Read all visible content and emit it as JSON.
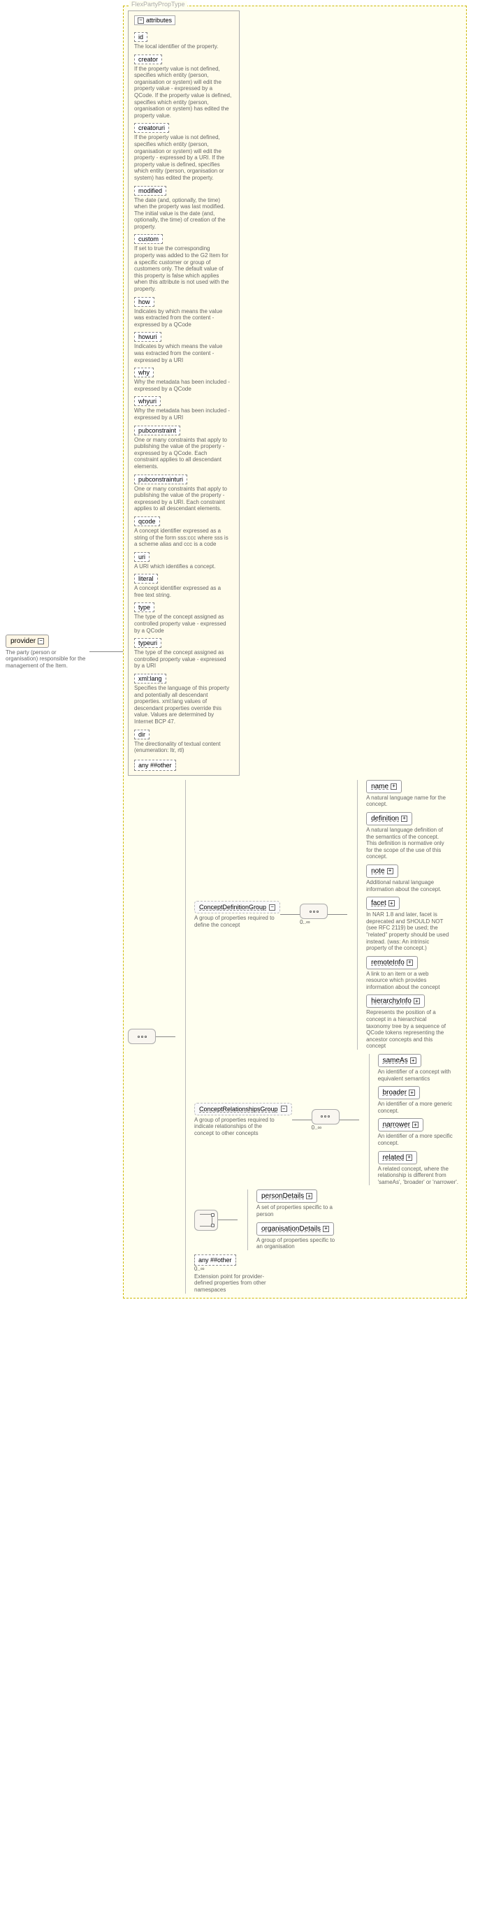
{
  "root": {
    "name": "provider",
    "annotation": "The party (person or organisation) responsible for the management of the Item."
  },
  "typeName": "FlexPartyPropType",
  "attributesHeader": "attributes",
  "otherAny": "any ##other",
  "attrs": [
    {
      "name": "id",
      "ann": "The local identifier of the property."
    },
    {
      "name": "creator",
      "ann": "If the property value is not defined, specifies which entity (person, organisation or system) will edit the property value - expressed by a QCode. If the property value is defined, specifies which entity (person, organisation or system) has edited the property value."
    },
    {
      "name": "creatoruri",
      "ann": "If the property value is not defined, specifies which entity (person, organisation or system) will edit the property - expressed by a URI. If the property value is defined, specifies which entity (person, organisation or system) has edited the property."
    },
    {
      "name": "modified",
      "ann": "The date (and, optionally, the time) when the property was last modified. The initial value is the date (and, optionally, the time) of creation of the property."
    },
    {
      "name": "custom",
      "ann": "If set to true the corresponding property was added to the G2 Item for a specific customer or group of customers only. The default value of this property is false which applies when this attribute is not used with the property."
    },
    {
      "name": "how",
      "ann": "Indicates by which means the value was extracted from the content - expressed by a QCode"
    },
    {
      "name": "howuri",
      "ann": "Indicates by which means the value was extracted from the content - expressed by a URI"
    },
    {
      "name": "why",
      "ann": "Why the metadata has been included - expressed by a QCode"
    },
    {
      "name": "whyuri",
      "ann": "Why the metadata has been included - expressed by a URI"
    },
    {
      "name": "pubconstraint",
      "ann": "One or many constraints that apply to publishing the value of the property - expressed by a QCode. Each constraint applies to all descendant elements."
    },
    {
      "name": "pubconstrainturi",
      "ann": "One or many constraints that apply to publishing the value of the property - expressed by a URI. Each constraint applies to all descendant elements."
    },
    {
      "name": "qcode",
      "ann": "A concept identifier expressed as a string of the form sss:ccc where sss is a scheme alias and ccc is a code"
    },
    {
      "name": "uri",
      "ann": "A URI which identifies a concept."
    },
    {
      "name": "literal",
      "ann": "A concept identifier expressed as a free text string."
    },
    {
      "name": "type",
      "ann": "The type of the concept assigned as controlled property value - expressed by a QCode"
    },
    {
      "name": "typeuri",
      "ann": "The type of the concept assigned as controlled property value - expressed by a URI"
    },
    {
      "name": "xml:lang",
      "ann": "Specifies the language of this property and potentially all descendant properties. xml:lang values of descendant properties override this value. Values are determined by Internet BCP 47."
    },
    {
      "name": "dir",
      "ann": "The directionality of textual content (enumeration: ltr, rtl)"
    }
  ],
  "groups": {
    "cdg": {
      "label": "ConceptDefinitionGroup",
      "ann": "A group of properties required to define the concept",
      "occ": "0..∞",
      "children": [
        {
          "name": "name",
          "ann": "A natural language name for the concept."
        },
        {
          "name": "definition",
          "ann": "A natural language definition of the semantics of the concept. This definition is normative only for the scope of the use of this concept."
        },
        {
          "name": "note",
          "ann": "Additional natural language information about the concept."
        },
        {
          "name": "facet",
          "ann": "In NAR 1.8 and later, facet is deprecated and SHOULD NOT (see RFC 2119) be used; the \"related\" property should be used instead. (was: An intrinsic property of the concept.)"
        },
        {
          "name": "remoteInfo",
          "ann": "A link to an item or a web resource which provides information about the concept"
        },
        {
          "name": "hierarchyInfo",
          "ann": "Represents the position of a concept in a hierarchical taxonomy tree by a sequence of QCode tokens representing the ancestor concepts and this concept"
        }
      ]
    },
    "crg": {
      "label": "ConceptRelationshipsGroup",
      "ann": "A group of properties required to indicate relationships of the concept to other concepts",
      "occ": "0..∞",
      "children": [
        {
          "name": "sameAs",
          "ann": "An identifier of a concept with equivalent semantics"
        },
        {
          "name": "broader",
          "ann": "An identifier of a more generic concept."
        },
        {
          "name": "narrower",
          "ann": "An identifier of a more specific concept."
        },
        {
          "name": "related",
          "ann": "A related concept, where the relationship is different from 'sameAs', 'broader' or 'narrower'."
        }
      ]
    },
    "choice": {
      "personDetails": {
        "name": "personDetails",
        "ann": "A set of properties specific to a person"
      },
      "organisationDetails": {
        "name": "organisationDetails",
        "ann": "A group of properties specific to an organisation"
      }
    },
    "anyOther": {
      "label": "any ##other",
      "occ": "0..∞",
      "ann": "Extension point for provider-defined properties from other namespaces"
    }
  }
}
